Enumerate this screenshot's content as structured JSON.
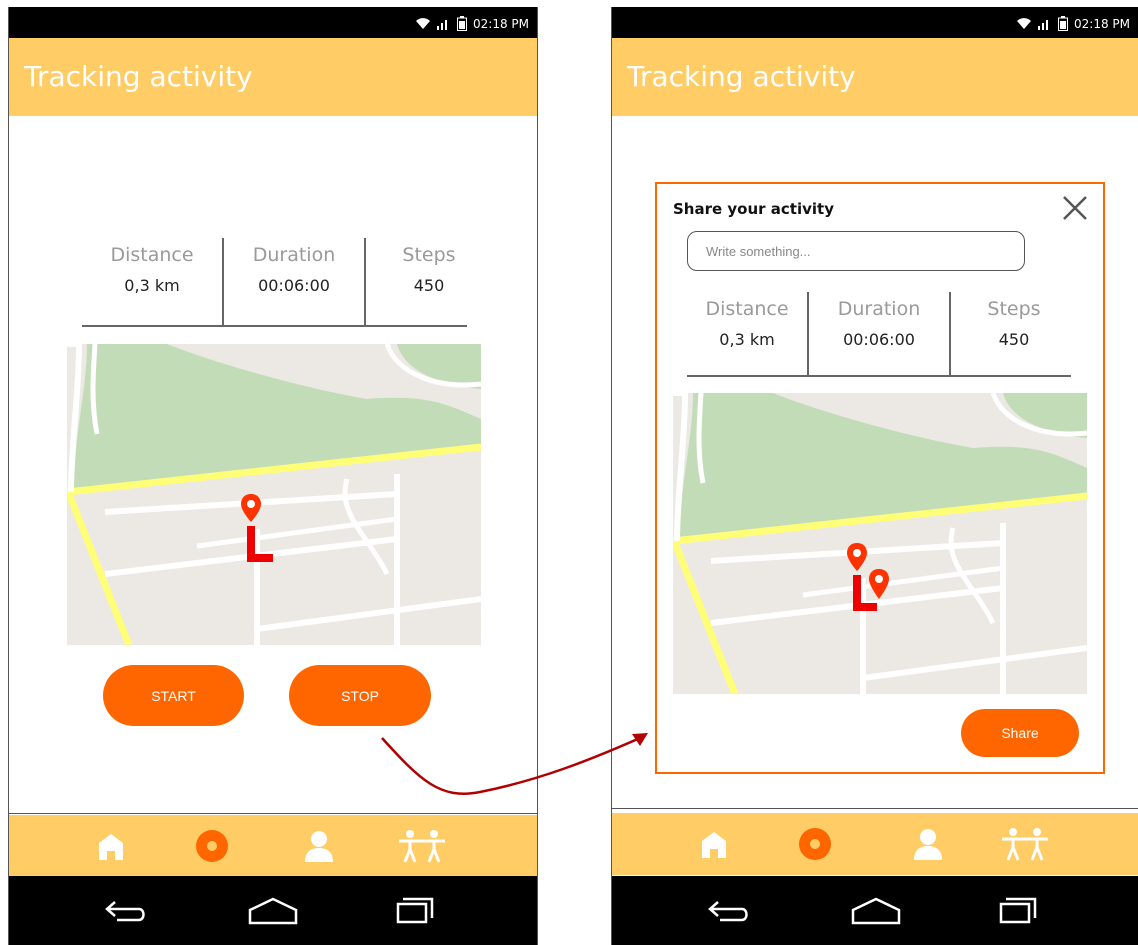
{
  "status_bar": {
    "time": "02:18 PM",
    "icons": [
      "wifi-icon",
      "signal-icon",
      "battery-icon"
    ]
  },
  "app": {
    "title": "Tracking activity"
  },
  "stats": [
    {
      "label": "Distance",
      "value": "0,3 km"
    },
    {
      "label": "Duration",
      "value": "00:06:00"
    },
    {
      "label": "Steps",
      "value": "450"
    }
  ],
  "buttons": {
    "start": "START",
    "stop": "STOP",
    "share": "Share"
  },
  "dialog": {
    "title": "Share your activity",
    "placeholder": "Write something..."
  },
  "nav": [
    "home-icon",
    "activity-icon",
    "profile-icon",
    "group-icon"
  ],
  "system_nav": [
    "back-icon",
    "home-outline-icon",
    "recents-icon"
  ],
  "colors": {
    "accent": "#ff6600",
    "bar": "#ffcc66",
    "park": "#c2dcb8",
    "map_bg": "#ece8e3",
    "road_major": "#ffff77"
  }
}
